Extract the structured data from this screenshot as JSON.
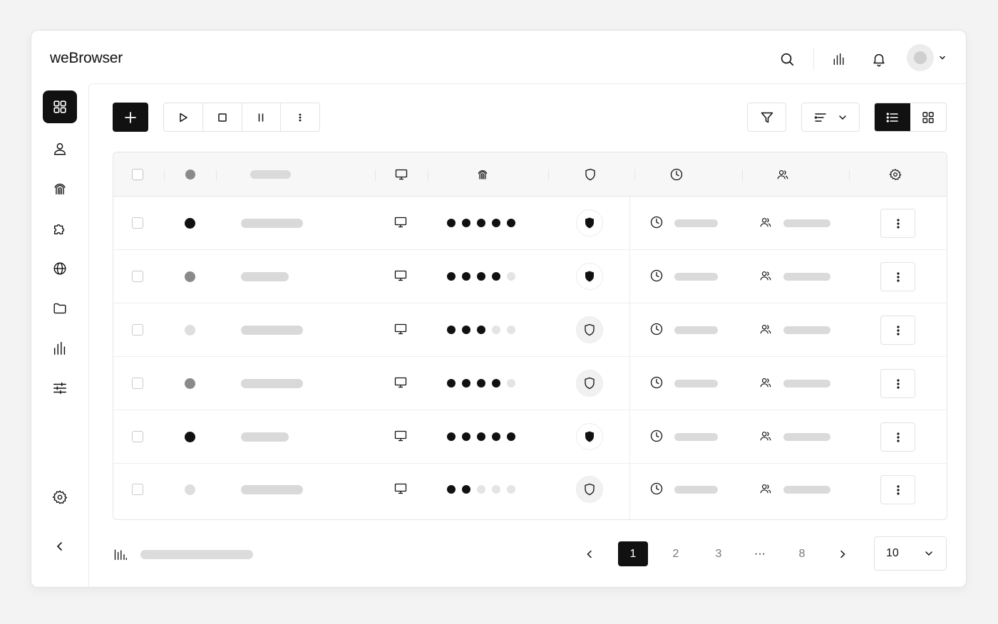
{
  "app": {
    "title": "weBrowser"
  },
  "header": {
    "icons": [
      "search-icon",
      "bar-chart-icon",
      "bell-icon",
      "avatar",
      "chevron-down-icon"
    ]
  },
  "sidebar": {
    "items": [
      {
        "icon": "grid-icon",
        "active": true
      },
      {
        "icon": "user-icon"
      },
      {
        "icon": "fingerprint-icon"
      },
      {
        "icon": "puzzle-icon"
      },
      {
        "icon": "globe-icon"
      },
      {
        "icon": "folder-icon"
      },
      {
        "icon": "bar-chart-icon"
      },
      {
        "icon": "sliders-icon"
      }
    ],
    "bottom": [
      "gear-icon",
      "chevron-left-icon"
    ]
  },
  "toolbar": {
    "left": [
      "plus-icon",
      "play-icon",
      "stop-icon",
      "pause-icon",
      "more-vertical-icon"
    ],
    "right": [
      "filter-icon",
      "sort-icon",
      "list-view-icon",
      "grid-view-icon"
    ],
    "active_view": "list"
  },
  "table": {
    "header_icons": [
      "select-all-checkbox",
      "status-dot",
      "name-placeholder",
      "monitor-icon",
      "fingerprint-icon",
      "shield-icon",
      "clock-icon",
      "users-icon",
      "gear-icon"
    ],
    "rows": [
      {
        "status": "active",
        "dots_filled": 5,
        "protected": true
      },
      {
        "status": "idle",
        "dots_filled": 4,
        "protected": true
      },
      {
        "status": "offline",
        "dots_filled": 3,
        "protected": false
      },
      {
        "status": "idle",
        "dots_filled": 4,
        "protected": false
      },
      {
        "status": "active",
        "dots_filled": 5,
        "protected": true
      },
      {
        "status": "offline",
        "dots_filled": 2,
        "protected": false
      }
    ],
    "dots_total": 5
  },
  "pagination": {
    "pages": [
      "1",
      "2",
      "3",
      "···",
      "8"
    ],
    "current": "1",
    "per_page": "10"
  },
  "colors": {
    "accent": "#111111",
    "status_active": "#111111",
    "status_idle": "#8a8a8a",
    "status_offline": "#dedede",
    "placeholder": "#d9d9d9"
  }
}
